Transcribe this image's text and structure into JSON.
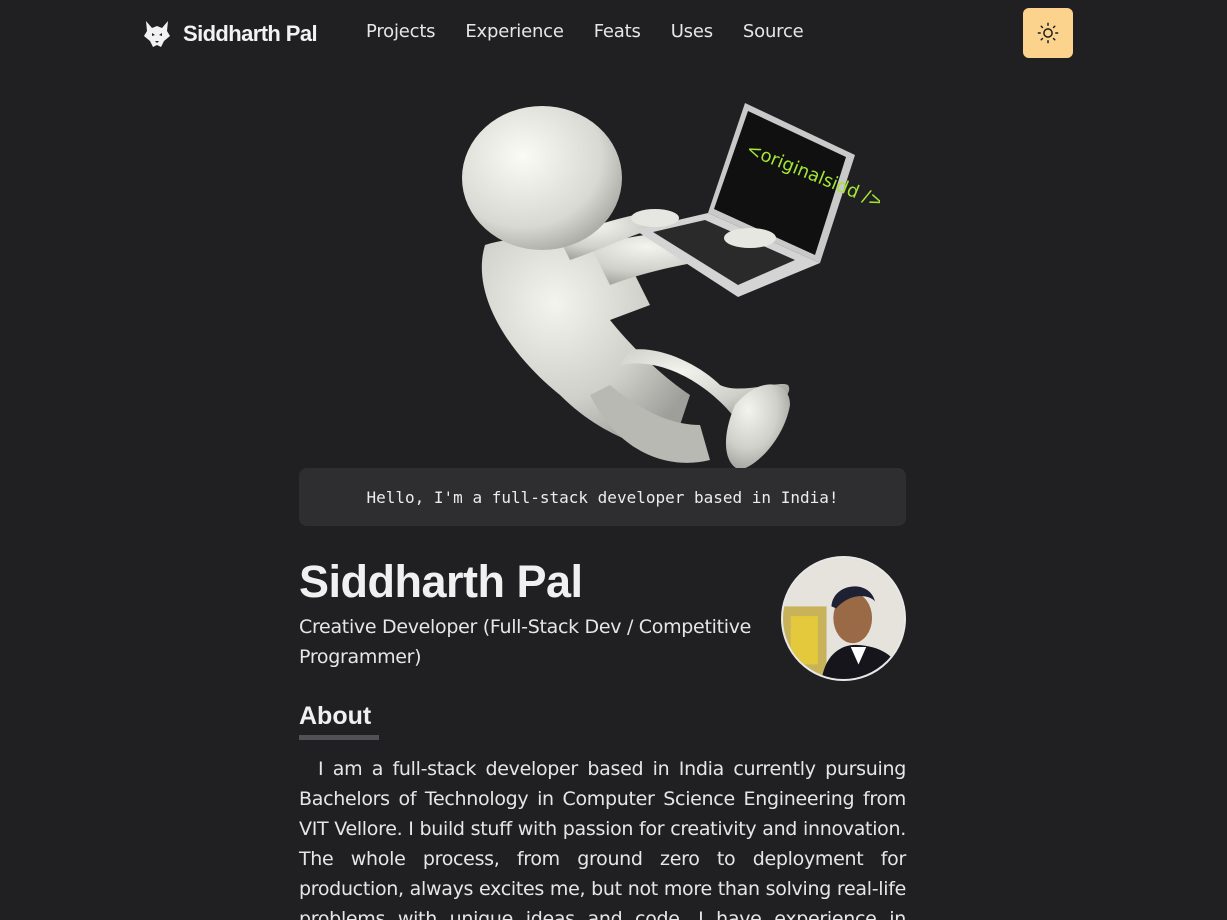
{
  "nav": {
    "brand": "Siddharth Pal",
    "links": [
      "Projects",
      "Experience",
      "Feats",
      "Uses",
      "Source"
    ],
    "theme_toggle_icon": "sun-icon"
  },
  "hero": {
    "laptop_screen_text": "<originalsidd />",
    "greeting": "Hello, I'm a full-stack developer based in India!"
  },
  "profile": {
    "name": "Siddharth Pal",
    "tagline": "Creative Developer (Full-Stack Dev / Competitive Programmer)"
  },
  "about": {
    "heading": "About",
    "text": "I am a full-stack developer based in India currently pursuing Bachelors of Technology in Computer Science Engineering from VIT Vellore. I build stuff with passion for creativity and innovation. The whole process, from ground zero to deployment for production, always excites me, but not more than solving real-life problems with unique ideas and code. I have experience in various fields such as"
  },
  "colors": {
    "background": "#202023",
    "accent": "#fbd38d",
    "card": "#2e2e31",
    "screen_text": "#a3e635"
  }
}
